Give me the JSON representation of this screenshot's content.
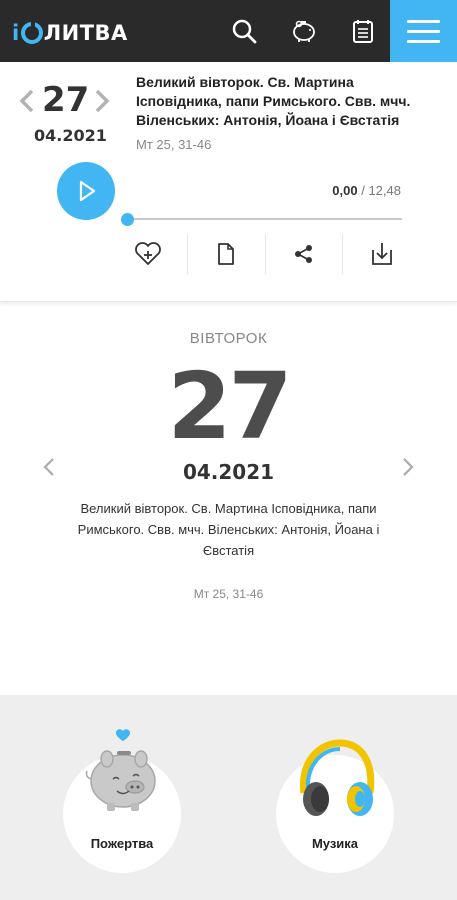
{
  "header": {
    "logo_prefix": "i",
    "logo_suffix": "ЛИТВА",
    "colors": {
      "background": "#2a2a2a",
      "accent": "#41b6f2"
    },
    "icons": [
      "search-icon",
      "piggy-bank-icon",
      "calendar-icon",
      "menu-icon"
    ]
  },
  "player": {
    "day": "27",
    "month_year": "04.2021",
    "title": "Великий вівторок. Св. Мартина Ісповідника, папи Римського. Свв. мчч. Віленських: Антонія, Йоана і Євстатія",
    "reference": "Мт 25, 31-46",
    "current_time": "0,00",
    "separator": " / ",
    "total_time": "12,48",
    "progress": 0,
    "actions": [
      "heart-plus-icon",
      "document-icon",
      "share-icon",
      "download-icon"
    ]
  },
  "day_view": {
    "weekday": "ВІВТОРОК",
    "day": "27",
    "month_year": "04.2021",
    "title": "Великий вівторок. Св. Мартина Ісповідника, папи Римського. Свв. мчч. Віленських: Антонія, Йоана і Євстатія",
    "reference": "Мт 25, 31-46"
  },
  "bottom": {
    "donation_label": "Пожертва",
    "music_label": "Музика"
  }
}
